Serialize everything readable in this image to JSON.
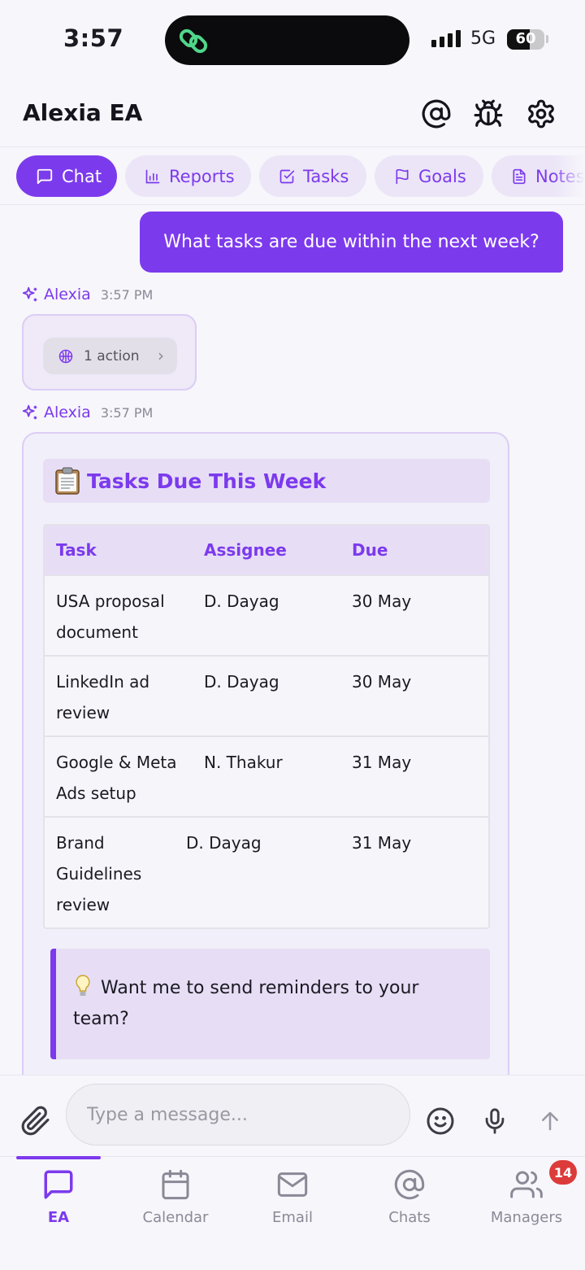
{
  "status_bar": {
    "time": "3:57",
    "network": "5G",
    "battery": "60",
    "battery_level": 0.6
  },
  "header": {
    "title": "Alexia EA"
  },
  "tabs": [
    {
      "label": "Chat",
      "icon": "chat-bubble-icon"
    },
    {
      "label": "Reports",
      "icon": "bar-chart-icon"
    },
    {
      "label": "Tasks",
      "icon": "checkbox-icon"
    },
    {
      "label": "Goals",
      "icon": "flag-icon"
    },
    {
      "label": "Notes",
      "icon": "document-icon"
    }
  ],
  "messages": {
    "user_text": "What tasks are due within the next week?",
    "assistant_name": "Alexia",
    "stamp1": "3:57 PM",
    "stamp2": "3:57 PM",
    "action_label": "1 action"
  },
  "answer": {
    "title": "Tasks Due This Week",
    "columns": [
      "Task",
      "Assignee",
      "Due"
    ],
    "rows": [
      {
        "task": "USA proposal document",
        "assignee": "D. Dayag",
        "due": "30 May"
      },
      {
        "task": "LinkedIn ad review",
        "assignee": "D. Dayag",
        "due": "30 May"
      },
      {
        "task": "Google & Meta Ads setup",
        "assignee": "N. Thakur",
        "due": "31 May"
      },
      {
        "task": "Brand Guidelines review",
        "assignee": "D. Dayag",
        "due": "31 May"
      }
    ],
    "callout": "Want me to send reminders to your team?"
  },
  "composer": {
    "placeholder": "Type a message..."
  },
  "nav": {
    "items": [
      {
        "label": "EA",
        "active": true
      },
      {
        "label": "Calendar"
      },
      {
        "label": "Email"
      },
      {
        "label": "Chats"
      },
      {
        "label": "Managers"
      }
    ],
    "managers_badge": "14"
  },
  "colors": {
    "accent": "#7c3aed",
    "accent_soft": "#ebe5f7",
    "badge": "#dc3b3b"
  }
}
